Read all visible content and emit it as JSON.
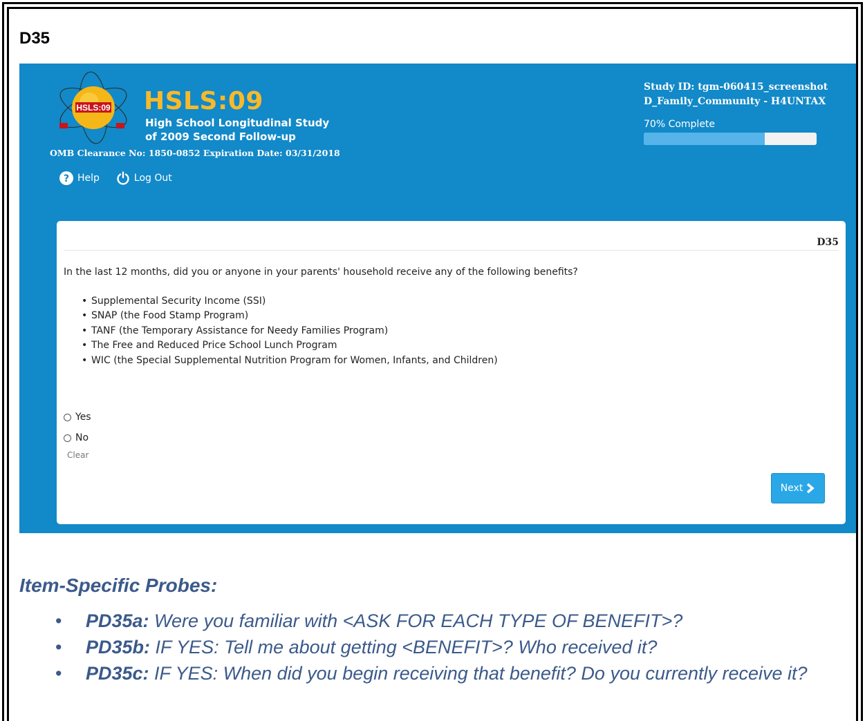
{
  "document": {
    "heading": "D35"
  },
  "header": {
    "title": "HSLS:09",
    "subtitle_line1": "High School Longitudinal Study",
    "subtitle_line2": "of 2009 Second Follow-up",
    "logo_text": "HSLS:09",
    "omb": "OMB Clearance No: 1850-0852 Expiration Date: 03/31/2018",
    "nav": {
      "help": "Help",
      "logout": "Log Out"
    },
    "study_id": "Study ID: tgm-060415_screenshot",
    "section": "D_Family_Community - H4UNTAX",
    "progress_label": "70% Complete",
    "progress_fraction": 0.7
  },
  "question": {
    "id": "D35",
    "text": "In the last 12 months, did you or anyone in your parents' household receive any of the following benefits?",
    "benefits": [
      "Supplemental Security Income (SSI)",
      "SNAP (the Food Stamp Program)",
      "TANF (the Temporary Assistance for Needy Families Program)",
      "The Free and Reduced Price School Lunch Program",
      "WIC (the Special Supplemental Nutrition Program for Women, Infants, and Children)"
    ],
    "options": [
      "Yes",
      "No"
    ],
    "clear_label": "Clear",
    "next_label": "Next"
  },
  "probes": {
    "heading": "Item-Specific Probes:",
    "items": [
      {
        "code": "PD35a:",
        "text": " Were you familiar with <ASK FOR EACH TYPE OF BENEFIT>?"
      },
      {
        "code": "PD35b:",
        "text": " IF YES: Tell me about getting <BENEFIT>? Who received it?"
      },
      {
        "code": "PD35c:",
        "text": " IF YES: When did you begin receiving that benefit? Do you currently receive it?"
      }
    ]
  },
  "colors": {
    "banner": "#1289c8",
    "brand_gold": "#f8b92a",
    "probe_text": "#3b5a8a",
    "progress_fill": "#56b4ea"
  }
}
